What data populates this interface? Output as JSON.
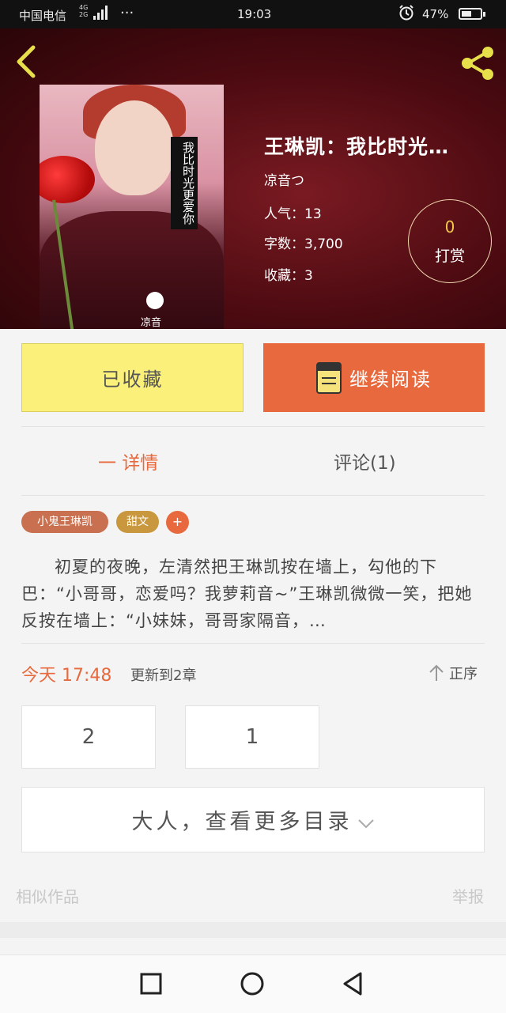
{
  "status_bar": {
    "carrier": "中国电信",
    "network_top": "4G",
    "network_bottom": "2G",
    "dots": "···",
    "time": "19:03",
    "battery": "47%"
  },
  "book": {
    "title": "王琳凯：我比时光…",
    "author": "凉音つ",
    "popularity": "人气：13",
    "word_count": "字数：3,700",
    "favorites": "收藏：3",
    "cover_text": "我比时光更爱你",
    "cover_brand": "凉音"
  },
  "reward": {
    "count": "0",
    "label": "打赏"
  },
  "actions": {
    "favorited_label": "已收藏",
    "continue_label": "继续阅读"
  },
  "tabs": {
    "details": "一 详情",
    "comments": "评论(1)"
  },
  "tags": [
    "小鬼王琳凯",
    "甜文"
  ],
  "tag_add": "+",
  "synopsis": "初夏的夜晚，左清然把王琳凯按在墙上，勾他的下巴：“小哥哥，恋爱吗？我萝莉音~”王琳凯微微一笑，把她反按在墙上：“小妹妹，哥哥家隔音，…",
  "update": {
    "time": "今天 17:48",
    "text": "更新到2章",
    "order": "正序"
  },
  "chapters": [
    "2",
    "1"
  ],
  "more_catalog": "大人，查看更多目录",
  "footer": {
    "similar": "相似作品",
    "report": "举报"
  },
  "colors": {
    "accent": "#e8693d",
    "favorite_bg": "#fbf17a",
    "hero_bg": "#4a0a10"
  }
}
